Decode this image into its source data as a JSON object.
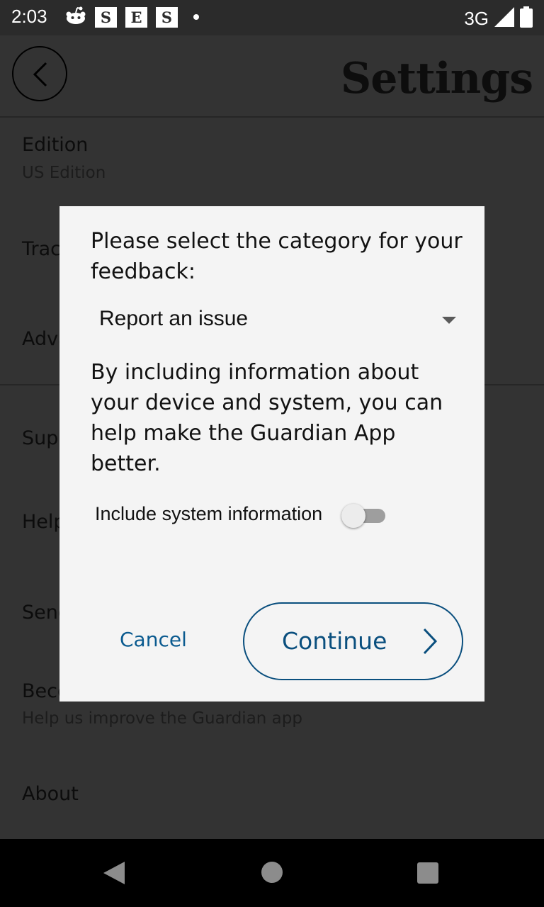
{
  "status_bar": {
    "time": "2:03",
    "notification_icons": [
      "reddit-icon",
      "S",
      "E",
      "S",
      "dot"
    ],
    "network": "3G",
    "signal_icon": "signal-icon",
    "battery_icon": "battery-icon"
  },
  "app_bar": {
    "title": "Settings",
    "back_icon": "back-chevron-icon"
  },
  "settings_list": {
    "edition_label": "Edition",
    "edition_value": "US Edition",
    "tracking_label": "Trac",
    "advanced_label": "Adva",
    "support_label": "Sup",
    "help_label": "Help",
    "send_label": "Send",
    "become_label": "Beco",
    "become_sub": "Help us improve the Guardian app",
    "about_label": "About"
  },
  "dialog": {
    "prompt": "Please select the category for your feedback:",
    "category_selected": "Report an issue",
    "info_text": "By including information about your device and system, you can help make the Guardian App better.",
    "toggle_label": "Include system information",
    "toggle_on": false,
    "cancel_label": "Cancel",
    "continue_label": "Continue"
  },
  "colors": {
    "accent": "#0a4f7e",
    "dialog_bg": "#f4f4f4",
    "scrim_bg": "#333333"
  }
}
